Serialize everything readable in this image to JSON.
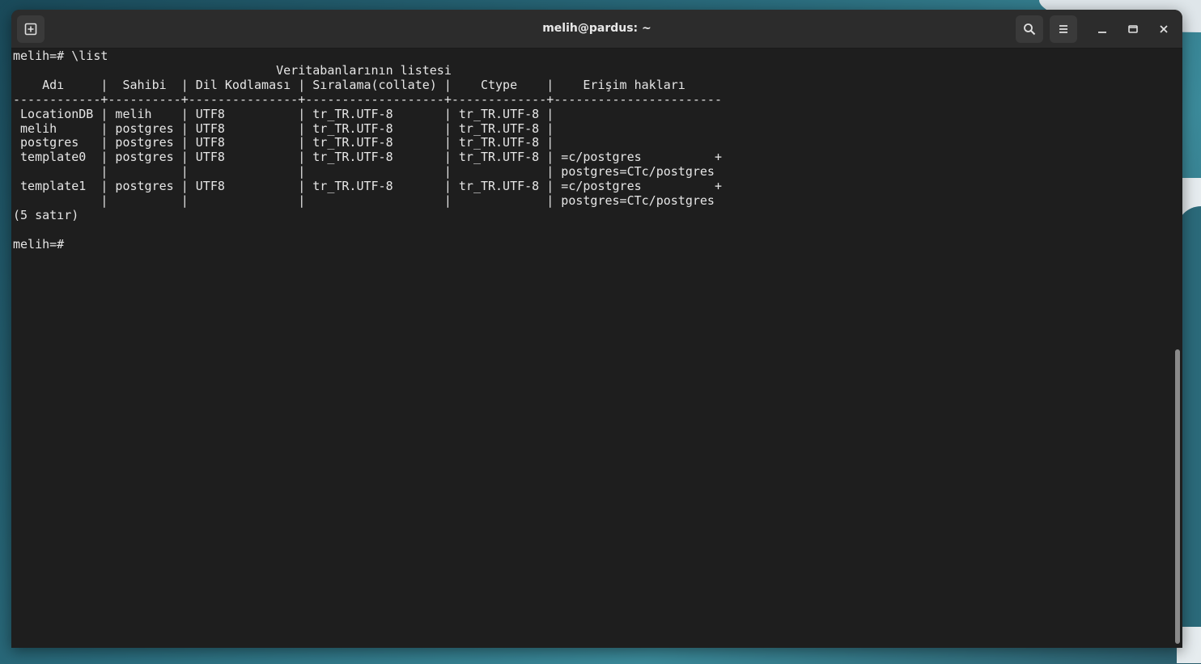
{
  "window": {
    "title": "melih@pardus: ~"
  },
  "terminal": {
    "lines": [
      "melih=# \\list",
      "                                    Veritabanlarının listesi",
      "    Adı     |  Sahibi  | Dil Kodlaması | Sıralama(collate) |    Ctype    |    Erişim hakları",
      "------------+----------+---------------+-------------------+-------------+-----------------------",
      " LocationDB | melih    | UTF8          | tr_TR.UTF-8       | tr_TR.UTF-8 |",
      " melih      | postgres | UTF8          | tr_TR.UTF-8       | tr_TR.UTF-8 |",
      " postgres   | postgres | UTF8          | tr_TR.UTF-8       | tr_TR.UTF-8 |",
      " template0  | postgres | UTF8          | tr_TR.UTF-8       | tr_TR.UTF-8 | =c/postgres          +",
      "            |          |               |                   |             | postgres=CTc/postgres",
      " template1  | postgres | UTF8          | tr_TR.UTF-8       | tr_TR.UTF-8 | =c/postgres          +",
      "            |          |               |                   |             | postgres=CTc/postgres",
      "(5 satır)",
      "",
      "melih=#"
    ]
  },
  "icons": {
    "new_tab": "new-tab-icon",
    "search": "search-icon",
    "menu": "hamburger-menu-icon",
    "minimize": "minimize-icon",
    "maximize": "maximize-icon",
    "close": "close-icon"
  }
}
